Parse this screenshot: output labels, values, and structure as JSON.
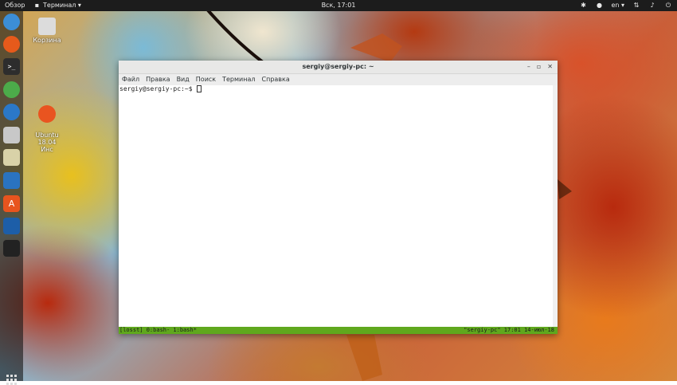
{
  "topbar": {
    "overview": "Обзор",
    "app_menu": "Терминал ▾",
    "clock": "Вск, 17:01",
    "lang": "en ▾"
  },
  "desktop": {
    "trash_label": "Корзина",
    "ubuntu_label": "Ubuntu\n18.04 Инс"
  },
  "window": {
    "title": "sergiy@sergiy-pc: ~",
    "menu": [
      "Файл",
      "Правка",
      "Вид",
      "Поиск",
      "Терминал",
      "Справка"
    ],
    "prompt": "sergiy@sergiy-pc:~$ ",
    "status_left": "[losst] 0:bash- 1:bash*",
    "status_right": "\"sergiy-pc\" 17:01 14-июл-18"
  },
  "colors": {
    "status_bar": "#5fa81d",
    "topbar": "#1c1c1c"
  },
  "dock_icons": [
    "chromium-icon",
    "firefox-icon",
    "terminal-icon",
    "network-icon",
    "thunderbird-icon",
    "files-icon",
    "disk-icon",
    "writer-icon",
    "software-center-icon",
    "virtualbox-icon",
    "inkscape-icon"
  ]
}
